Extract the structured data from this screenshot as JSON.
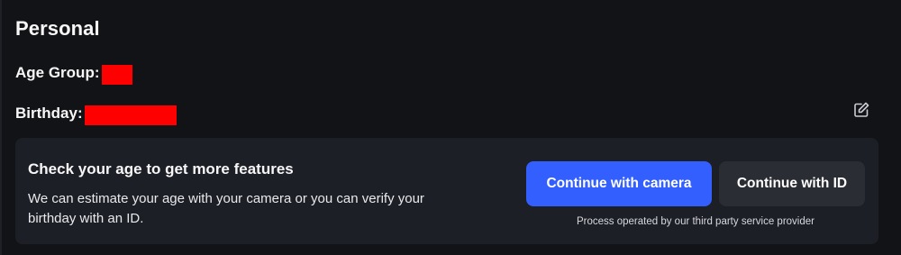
{
  "section": {
    "title": "Personal"
  },
  "fields": {
    "age_group_label": "Age Group:",
    "birthday_label": "Birthday:"
  },
  "icons": {
    "edit": "edit-icon"
  },
  "colors": {
    "background": "#121317",
    "card": "#1d1f26",
    "primary_button": "#335fff",
    "secondary_button": "#2b2d35",
    "redaction": "#ff0000"
  },
  "age_card": {
    "title": "Check your age to get more features",
    "description": "We can estimate your age with your camera or you can verify your birthday with an ID.",
    "camera_button": "Continue with camera",
    "id_button": "Continue with ID",
    "provider_note": "Process operated by our third party service provider"
  }
}
